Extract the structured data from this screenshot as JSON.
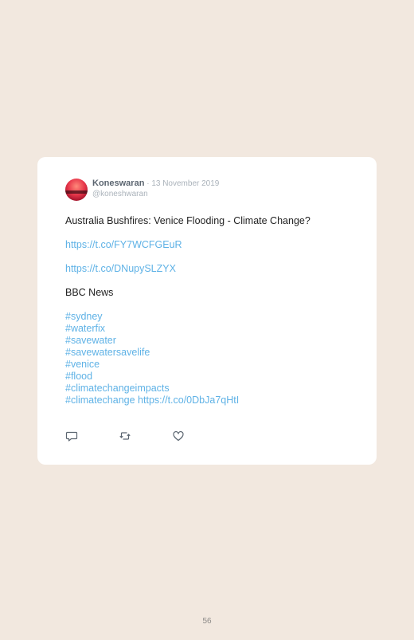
{
  "tweet": {
    "author_name": "Koneswaran",
    "separator": " · ",
    "date": "13 November 2019",
    "handle": "@koneshwaran",
    "text_line": "Australia Bushfires: Venice Flooding - Climate Change?",
    "link1": "https://t.co/FY7WCFGEuR",
    "link2": "https://t.co/DNupySLZYX",
    "source": "BBC News",
    "hashtags": [
      "#sydney",
      "#waterfix",
      "#savewater",
      "#savewatersavelife",
      "#venice",
      "#flood",
      "#climatechangeimpacts",
      "#climatechange"
    ],
    "final_link": "https://t.co/0DbJa7qHtI"
  },
  "actions": {
    "reply_icon": "reply-icon",
    "retweet_icon": "retweet-icon",
    "like_icon": "heart-icon"
  },
  "page_number": "56",
  "colors": {
    "background": "#f2e8df",
    "card": "#ffffff",
    "link": "#5fb2e6"
  }
}
